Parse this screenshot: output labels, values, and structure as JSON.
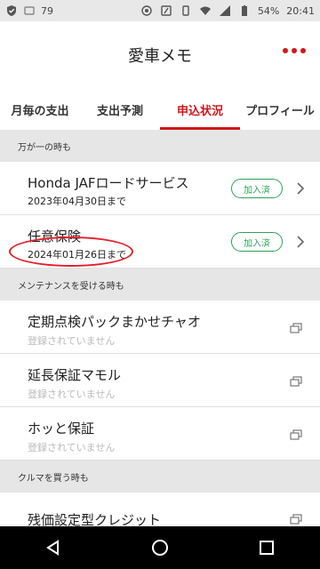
{
  "status_bar": {
    "left_text": "79",
    "battery": "54%",
    "time": "20:41"
  },
  "header": {
    "title": "愛車メモ"
  },
  "tabs": [
    {
      "label": "月毎の支出"
    },
    {
      "label": "支出予測"
    },
    {
      "label": "申込状況"
    },
    {
      "label": "プロフィール"
    }
  ],
  "sections": [
    {
      "header": "万が一の時も",
      "items": [
        {
          "title": "Honda JAFロードサービス",
          "subtitle": "2023年04月30日まで",
          "badge": "加入済"
        },
        {
          "title": "任意保険",
          "subtitle": "2024年01月26日まで",
          "badge": "加入済"
        }
      ]
    },
    {
      "header": "メンテナンスを受ける時も",
      "items": [
        {
          "title": "定期点検パックまかせチャオ",
          "subtitle": "登録されていません"
        },
        {
          "title": "延長保証マモル",
          "subtitle": "登録されていません"
        },
        {
          "title": "ホッと保証",
          "subtitle": "登録されていません"
        }
      ]
    },
    {
      "header": "クルマを買う時も",
      "items": [
        {
          "title": "残価設定型クレジット"
        }
      ]
    }
  ],
  "colors": {
    "accent": "#d0161b",
    "badge_green": "#2aa457",
    "section_bg": "#e6e6e6"
  }
}
